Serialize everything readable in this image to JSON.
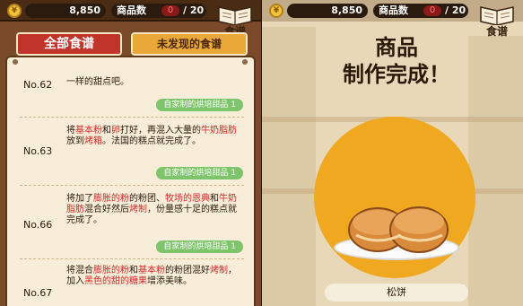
{
  "header": {
    "coins": "8,850",
    "coin_symbol": "¥",
    "product_count_label": "商品数",
    "product_count_current": "0",
    "product_count_total": "/ 20",
    "recipe_book_label": "食谱"
  },
  "tabs": {
    "all_recipes": "全部食谱",
    "undiscovered": "未发现的食谱"
  },
  "recipes": [
    {
      "number": "No.62",
      "desc": [
        "一样的甜点吧。"
      ],
      "tag": "自家制的烘培甜品 1"
    },
    {
      "number": "No.63",
      "desc_parts": [
        {
          "t": "将",
          "c": ""
        },
        {
          "t": "基本粉",
          "c": "hl"
        },
        {
          "t": "和",
          "c": ""
        },
        {
          "t": "卵",
          "c": "hl"
        },
        {
          "t": "打好，再混入大量的",
          "c": ""
        },
        {
          "t": "牛奶脂肪",
          "c": "hl"
        },
        {
          "t": "放到",
          "c": ""
        },
        {
          "t": "烤箱",
          "c": "hl"
        },
        {
          "t": "。法国的糕点就完成了。",
          "c": ""
        }
      ],
      "tag": "自家制的烘培甜品 1"
    },
    {
      "number": "No.66",
      "desc_parts": [
        {
          "t": "将加了",
          "c": ""
        },
        {
          "t": "膨胀的粉",
          "c": "hl"
        },
        {
          "t": "的粉团、",
          "c": ""
        },
        {
          "t": "牧场的恩典",
          "c": "hl"
        },
        {
          "t": "和",
          "c": ""
        },
        {
          "t": "牛奶",
          "c": "hl"
        },
        {
          "t": "脂肪",
          "c": "hl"
        },
        {
          "t": "混合好然后",
          "c": ""
        },
        {
          "t": "烤制",
          "c": "hl"
        },
        {
          "t": "，份量感十足的糕点就",
          "c": ""
        },
        {
          "t": "完成了。",
          "c": ""
        }
      ],
      "tag": "自家制的烘培甜品 1"
    },
    {
      "number": "No.67",
      "desc_parts": [
        {
          "t": "将混合",
          "c": ""
        },
        {
          "t": "膨胀的粉",
          "c": "hl"
        },
        {
          "t": "和",
          "c": ""
        },
        {
          "t": "基本粉",
          "c": "hl"
        },
        {
          "t": "的粉团混好",
          "c": ""
        },
        {
          "t": "烤制",
          "c": "hl"
        },
        {
          "t": "，",
          "c": ""
        },
        {
          "t": "加入",
          "c": ""
        },
        {
          "t": "黑色的甜的糖果",
          "c": "hl"
        },
        {
          "t": "增添美味。",
          "c": ""
        }
      ],
      "tag": ""
    }
  ],
  "result": {
    "title_line1": "商品",
    "title_line2": "制作完成！",
    "food_name": "松饼"
  },
  "colors": {
    "accent_red": "#c0342a",
    "tab_orange": "#e9a838",
    "tag_green": "#7dc46a",
    "circle_orange": "#f0a820"
  }
}
